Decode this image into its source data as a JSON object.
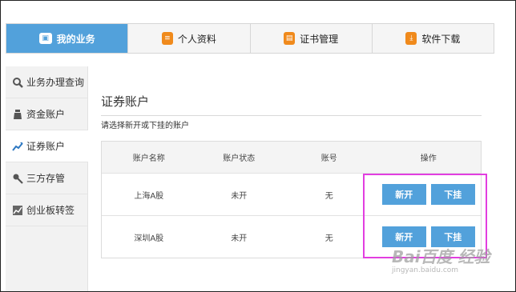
{
  "tabs": [
    {
      "label": "我的业务",
      "active": true,
      "icon": "briefcase-icon"
    },
    {
      "label": "个人资料",
      "active": false,
      "icon": "document-icon"
    },
    {
      "label": "证书管理",
      "active": false,
      "icon": "certificate-icon"
    },
    {
      "label": "软件下载",
      "active": false,
      "icon": "download-icon"
    }
  ],
  "sidebar": {
    "items": [
      {
        "label": "业务办理查询",
        "icon": "search-icon"
      },
      {
        "label": "资金账户",
        "icon": "money-bag-icon"
      },
      {
        "label": "证券账户",
        "icon": "trend-icon",
        "active": true
      },
      {
        "label": "三方存管",
        "icon": "key-icon"
      },
      {
        "label": "创业板转签",
        "icon": "chart-icon"
      }
    ]
  },
  "main": {
    "title": "证券账户",
    "hint": "请选择新开或下挂的账户",
    "table": {
      "headers": [
        "账户名称",
        "账户状态",
        "账号",
        "操作"
      ],
      "rows": [
        {
          "name": "上海A股",
          "status": "未开",
          "account": "无",
          "open_label": "新开",
          "attach_label": "下挂"
        },
        {
          "name": "深圳A股",
          "status": "未开",
          "account": "无",
          "open_label": "新开",
          "attach_label": "下挂"
        }
      ]
    }
  },
  "watermark": {
    "main": "Bai百度 经验",
    "sub": "jingyan.baidu.com"
  },
  "colors": {
    "accent": "#52a1db",
    "highlight": "#e23ee0",
    "icon_orange": "#f08a1c"
  }
}
